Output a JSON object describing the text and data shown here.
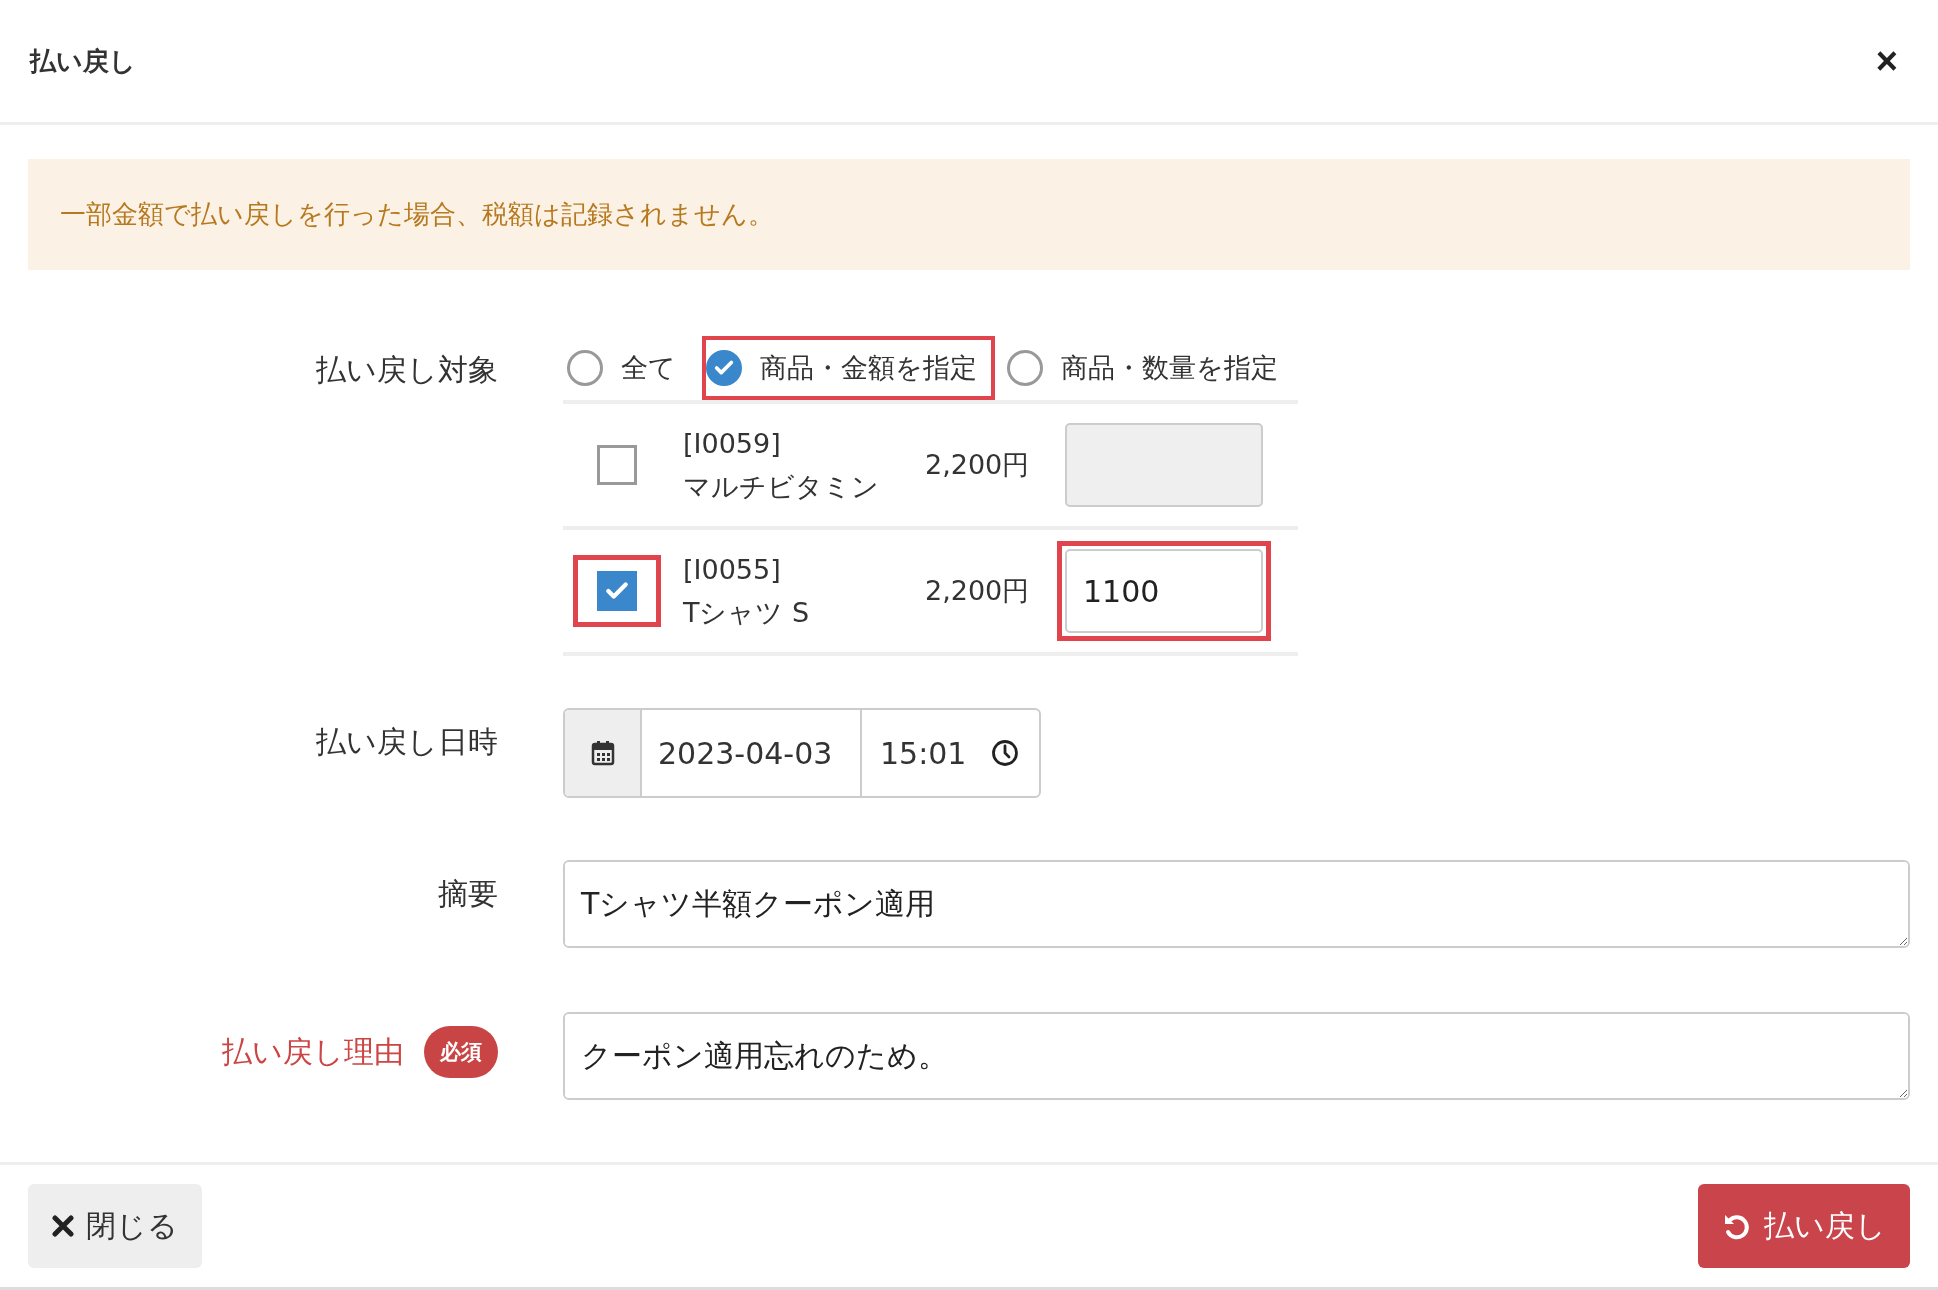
{
  "dialog": {
    "title": "払い戻し",
    "close_icon": "×"
  },
  "alert": "一部金額で払い戻しを行った場合、税額は記録されません。",
  "target": {
    "label": "払い戻し対象",
    "options": [
      {
        "label": "全て",
        "selected": false,
        "highlighted": false
      },
      {
        "label": "商品・金額を指定",
        "selected": true,
        "highlighted": true
      },
      {
        "label": "商品・数量を指定",
        "selected": false,
        "highlighted": false
      }
    ],
    "items": [
      {
        "code": "[I0059]",
        "name": "マルチビタミン",
        "price": "2,200円",
        "checked": false,
        "highlighted": false
      },
      {
        "code": "[I0055]",
        "name": "Tシャツ S",
        "price": "2,200円",
        "checked": true,
        "amount": "1100",
        "highlighted": true
      }
    ]
  },
  "datetime": {
    "label": "払い戻し日時",
    "date": "2023-04-03",
    "time": "15:01"
  },
  "summary": {
    "label": "摘要",
    "value": "Tシャツ半額クーポン適用"
  },
  "reason": {
    "label": "払い戻し理由",
    "badge": "必須",
    "value": "クーポン適用忘れのため。"
  },
  "footer": {
    "close": "閉じる",
    "refund": "払い戻し"
  }
}
